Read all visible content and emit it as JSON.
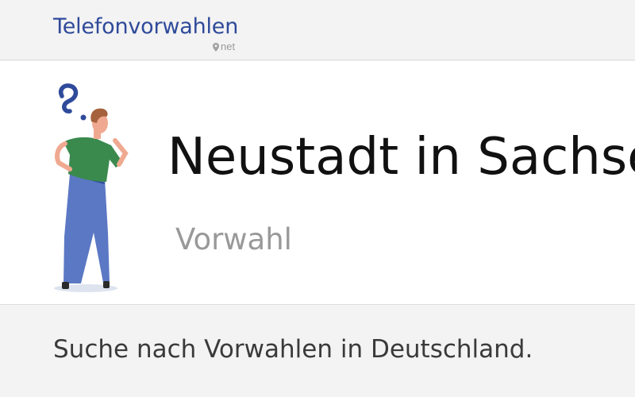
{
  "header": {
    "logo_text": "Telefonvorwahlen",
    "logo_sub": "net",
    "logo_icon": "location-pin-icon"
  },
  "hero": {
    "illustration": "thinking-person-with-question-mark",
    "title": "Neustadt in Sachsen",
    "subtitle": "Vorwahl"
  },
  "main": {
    "intro": "Suche nach Vorwahlen in Deutschland."
  },
  "colors": {
    "brand": "#2f4a9a",
    "background": "#f3f3f3",
    "hero_background": "#ffffff",
    "muted": "#999999",
    "shirt": "#3a8a4e",
    "trousers": "#5b78c4"
  }
}
